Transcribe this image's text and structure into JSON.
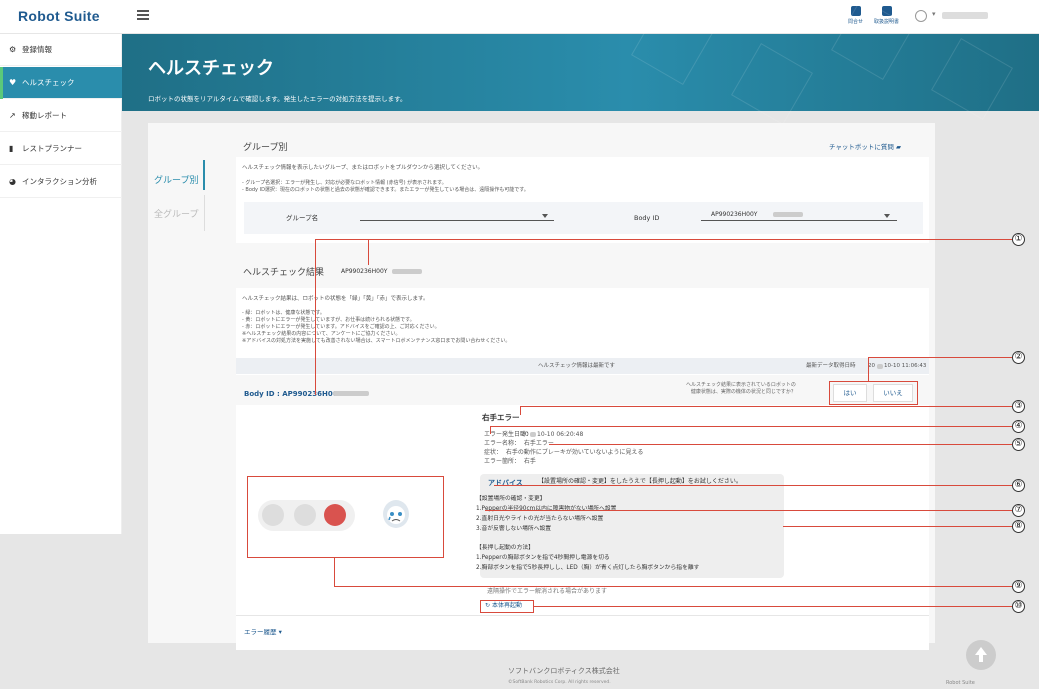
{
  "app": {
    "logo": "Robot Suite",
    "footer_brand": "Robot Suite"
  },
  "topbar": {
    "contact_label": "問合せ",
    "manual_label": "取扱説明書"
  },
  "sidebar": {
    "items": [
      {
        "label": "登録情報",
        "icon": "gear-icon"
      },
      {
        "label": "ヘルスチェック",
        "icon": "heart-icon",
        "active": true
      },
      {
        "label": "稼動レポート",
        "icon": "chart-icon"
      },
      {
        "label": "レストプランナー",
        "icon": "bar-icon"
      },
      {
        "label": "インタラクション分析",
        "icon": "pie-icon"
      }
    ]
  },
  "hero": {
    "title": "ヘルスチェック",
    "subtitle": "ロボットの状態をリアルタイムで確認します。発生したエラーの対処方法を提示します。"
  },
  "tabs": {
    "group": "グループ別",
    "all": "全グループ"
  },
  "group_section": {
    "title": "グループ別",
    "chatbot": "チャットボットに質問",
    "desc": "ヘルスチェック情報を表示したいグループ、またはロボットをプルダウンから選択してください。",
    "note1": "- グループ名選択：エラーが発生し、対応が必要なロボット情報 (赤信号) が表示されます。",
    "note2": "- Body ID選択：現在のロボットの状態と過去の状態が確認できます。またエラーが発生している場合は、遠隔操作も可能です。",
    "group_label": "グループ名",
    "bodyid_label": "Body ID",
    "bodyid_value": "AP990236H00Y"
  },
  "result": {
    "title": "ヘルスチェック結果",
    "id": "AP990236H00Y",
    "desc": "ヘルスチェック結果は、ロボットの状態を「緑」「黄」「赤」で表示します。",
    "lines": [
      "- 緑：ロボットは、健康な状態です。",
      "- 黄：ロボットにエラーが発生していますが、お仕事は続けられる状態です。",
      "- 赤：ロボットにエラーが発生しています。アドバイスをご確認の上、ご対応ください。",
      "※ヘルスチェック結果の内容について、アンケートにご協力ください。",
      "※アドバイスの対処方法を実施しても改善されない場合は、スマートロボメンテナンス窓口までお問い合わせください。"
    ],
    "latest": "ヘルスチェック情報は最新です",
    "fetch_label": "最新データ取得日時",
    "fetch_prefix": "20",
    "fetch_suffix": "10-10 11:06:43",
    "body_id_label": "Body ID : AP990236H00Y",
    "survey": "ヘルスチェック結果に表示されているロボットの\n健康状態は、実際の機体の状況と同じですか？",
    "yes": "はい",
    "no": "いいえ"
  },
  "error": {
    "title": "右手エラー",
    "date_label": "エラー発生日時：",
    "date_prefix": "20",
    "date_suffix": "10-10 06:20:48",
    "name": "エラー名称：  右手エラー",
    "symptom": "症状：  右手の動作にブレーキが効いていないように見える",
    "location": "エラー箇所：  右手",
    "advice_label": "アドバイス",
    "advice_head": "【設置場所の確認・変更】をしたうえで【長押し起動】をお試しください。",
    "advice_body": [
      "【設置場所の確認・変更】",
      "1.Pepperの半径90cm以内に障害物がない場所へ設置",
      "2.直射日光やライトの光が当たらない場所へ設置",
      "3.音が反響しない場所へ設置",
      "",
      "【長押し起動の方法】",
      "1.Pepperの胸部ボタンを指で4秒間押し電源を切る",
      "2.胸部ボタンを指で5秒長押しし、LED（胸）が青く点灯したら胸ボタンから指を離す"
    ],
    "remote_note": "遠隔操作でエラー解消される場合があります",
    "restart": "本体再起動",
    "history": "エラー履歴"
  },
  "callouts": [
    "①",
    "②",
    "③",
    "④",
    "⑤",
    "⑥",
    "⑦",
    "⑧",
    "⑨",
    "⑩"
  ],
  "footer": {
    "company": "ソフトバンクロボティクス株式会社",
    "copyright": "©SoftBank Robotics Corp. All rights reserved."
  },
  "colors": {
    "accent": "#2a8dac",
    "brand": "#1f5a8f",
    "status_red": "#d9534f",
    "annotation": "#d84a3c"
  }
}
